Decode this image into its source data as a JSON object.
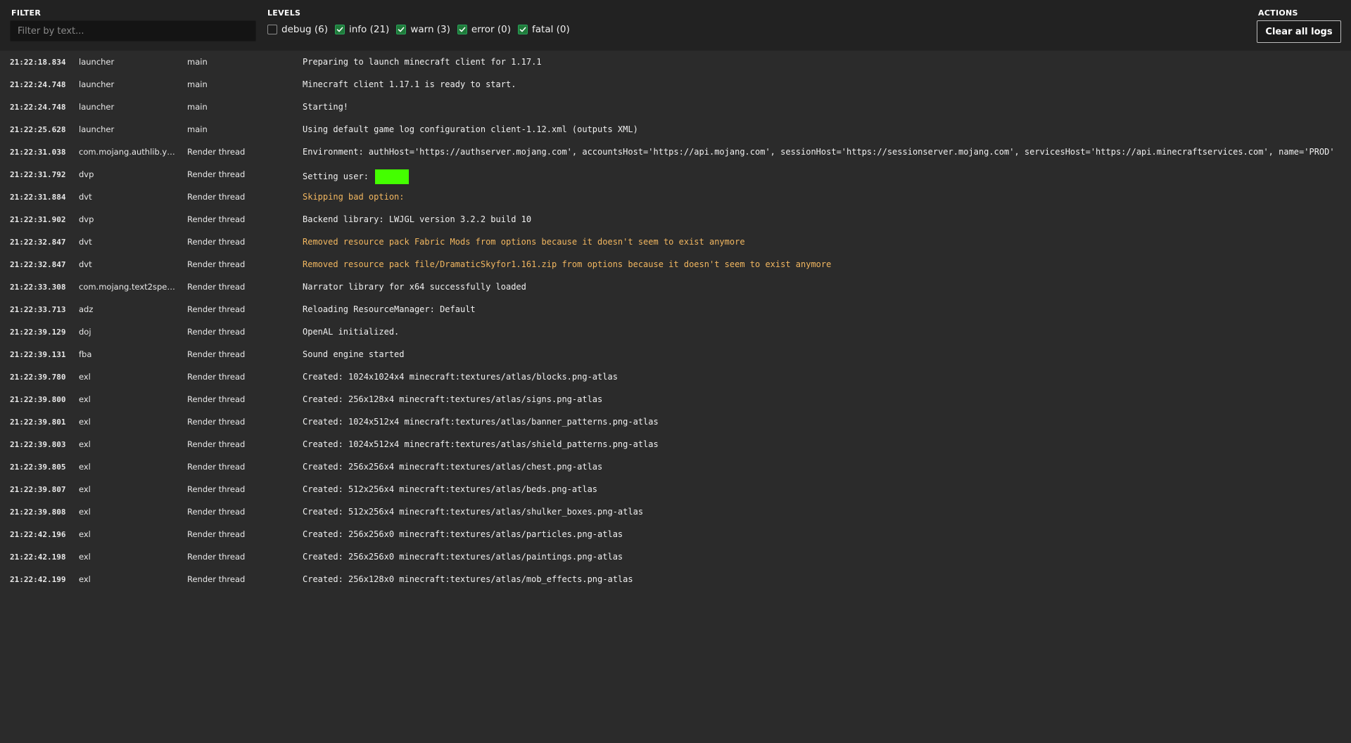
{
  "toolbar": {
    "filter_label": "FILTER",
    "filter_placeholder": "Filter by text...",
    "filter_value": "",
    "levels_label": "LEVELS",
    "levels": [
      {
        "label": "debug (6)",
        "checked": false
      },
      {
        "label": "info (21)",
        "checked": true
      },
      {
        "label": "warn (3)",
        "checked": true
      },
      {
        "label": "error (0)",
        "checked": true
      },
      {
        "label": "fatal (0)",
        "checked": true
      }
    ],
    "actions_label": "ACTIONS",
    "clear_label": "Clear all logs"
  },
  "colors": {
    "background": "#2b2b2b",
    "toolbar": "#222222",
    "warn_text": "#f2b760",
    "checkbox_on": "#1f7a3a",
    "redaction": "#44ff00"
  },
  "logs": [
    {
      "time": "21:22:18.834",
      "source": "launcher",
      "thread": "main",
      "message": "Preparing to launch minecraft client for 1.17.1",
      "level": "info"
    },
    {
      "time": "21:22:24.748",
      "source": "launcher",
      "thread": "main",
      "message": "Minecraft client 1.17.1 is ready to start.",
      "level": "info"
    },
    {
      "time": "21:22:24.748",
      "source": "launcher",
      "thread": "main",
      "message": "Starting!",
      "level": "info"
    },
    {
      "time": "21:22:25.628",
      "source": "launcher",
      "thread": "main",
      "message": "Using default game log configuration client-1.12.xml (outputs XML)",
      "level": "info"
    },
    {
      "time": "21:22:31.038",
      "source": "com.mojang.authlib.y…",
      "thread": "Render thread",
      "message": "Environment: authHost='https://authserver.mojang.com', accountsHost='https://api.mojang.com', sessionHost='https://sessionserver.mojang.com', servicesHost='https://api.minecraftservices.com', name='PROD'",
      "level": "info"
    },
    {
      "time": "21:22:31.792",
      "source": "dvp",
      "thread": "Render thread",
      "message": "Setting user:",
      "level": "info",
      "redacted": true
    },
    {
      "time": "21:22:31.884",
      "source": "dvt",
      "thread": "Render thread",
      "message": "Skipping bad option:",
      "level": "warn"
    },
    {
      "time": "21:22:31.902",
      "source": "dvp",
      "thread": "Render thread",
      "message": "Backend library: LWJGL version 3.2.2 build 10",
      "level": "info"
    },
    {
      "time": "21:22:32.847",
      "source": "dvt",
      "thread": "Render thread",
      "message": "Removed resource pack Fabric Mods from options because it doesn't seem to exist anymore",
      "level": "warn"
    },
    {
      "time": "21:22:32.847",
      "source": "dvt",
      "thread": "Render thread",
      "message": "Removed resource pack file/DramaticSkyfor1.161.zip from options because it doesn't seem to exist anymore",
      "level": "warn"
    },
    {
      "time": "21:22:33.308",
      "source": "com.mojang.text2spee…",
      "thread": "Render thread",
      "message": "Narrator library for x64 successfully loaded",
      "level": "info"
    },
    {
      "time": "21:22:33.713",
      "source": "adz",
      "thread": "Render thread",
      "message": "Reloading ResourceManager: Default",
      "level": "info"
    },
    {
      "time": "21:22:39.129",
      "source": "doj",
      "thread": "Render thread",
      "message": "OpenAL initialized.",
      "level": "info"
    },
    {
      "time": "21:22:39.131",
      "source": "fba",
      "thread": "Render thread",
      "message": "Sound engine started",
      "level": "info"
    },
    {
      "time": "21:22:39.780",
      "source": "exl",
      "thread": "Render thread",
      "message": "Created: 1024x1024x4 minecraft:textures/atlas/blocks.png-atlas",
      "level": "info"
    },
    {
      "time": "21:22:39.800",
      "source": "exl",
      "thread": "Render thread",
      "message": "Created: 256x128x4 minecraft:textures/atlas/signs.png-atlas",
      "level": "info"
    },
    {
      "time": "21:22:39.801",
      "source": "exl",
      "thread": "Render thread",
      "message": "Created: 1024x512x4 minecraft:textures/atlas/banner_patterns.png-atlas",
      "level": "info"
    },
    {
      "time": "21:22:39.803",
      "source": "exl",
      "thread": "Render thread",
      "message": "Created: 1024x512x4 minecraft:textures/atlas/shield_patterns.png-atlas",
      "level": "info"
    },
    {
      "time": "21:22:39.805",
      "source": "exl",
      "thread": "Render thread",
      "message": "Created: 256x256x4 minecraft:textures/atlas/chest.png-atlas",
      "level": "info"
    },
    {
      "time": "21:22:39.807",
      "source": "exl",
      "thread": "Render thread",
      "message": "Created: 512x256x4 minecraft:textures/atlas/beds.png-atlas",
      "level": "info"
    },
    {
      "time": "21:22:39.808",
      "source": "exl",
      "thread": "Render thread",
      "message": "Created: 512x256x4 minecraft:textures/atlas/shulker_boxes.png-atlas",
      "level": "info"
    },
    {
      "time": "21:22:42.196",
      "source": "exl",
      "thread": "Render thread",
      "message": "Created: 256x256x0 minecraft:textures/atlas/particles.png-atlas",
      "level": "info"
    },
    {
      "time": "21:22:42.198",
      "source": "exl",
      "thread": "Render thread",
      "message": "Created: 256x256x0 minecraft:textures/atlas/paintings.png-atlas",
      "level": "info"
    },
    {
      "time": "21:22:42.199",
      "source": "exl",
      "thread": "Render thread",
      "message": "Created: 256x128x0 minecraft:textures/atlas/mob_effects.png-atlas",
      "level": "info"
    }
  ]
}
